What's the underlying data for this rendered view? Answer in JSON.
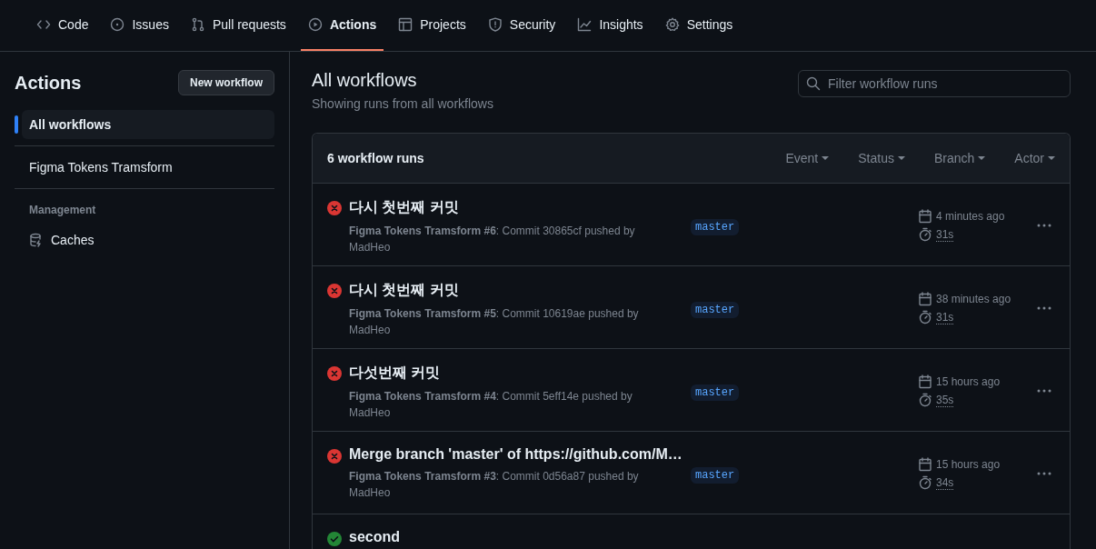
{
  "tabs": [
    {
      "label": "Code",
      "selected": false
    },
    {
      "label": "Issues",
      "selected": false
    },
    {
      "label": "Pull requests",
      "selected": false
    },
    {
      "label": "Actions",
      "selected": true
    },
    {
      "label": "Projects",
      "selected": false
    },
    {
      "label": "Security",
      "selected": false
    },
    {
      "label": "Insights",
      "selected": false
    },
    {
      "label": "Settings",
      "selected": false
    }
  ],
  "sidebar": {
    "title": "Actions",
    "new_button": "New workflow",
    "items": [
      {
        "label": "All workflows",
        "selected": true
      },
      {
        "label": "Figma Tokens Tramsform",
        "selected": false
      }
    ],
    "section_heading": "Management",
    "section_items": [
      {
        "label": "Caches",
        "selected": false
      }
    ]
  },
  "main": {
    "title": "All workflows",
    "subtitle": "Showing runs from all workflows",
    "search": {
      "placeholder": "Filter workflow runs"
    },
    "runs_count": "6 workflow runs",
    "filters": [
      "Event",
      "Status",
      "Branch",
      "Actor"
    ],
    "runs": [
      {
        "kind": "failure",
        "title": "다시 첫번째 커밋",
        "description": "**Figma Tokens Tramsform #6**: Commit 30865cf pushed by MadHeo",
        "branch": "master",
        "time": "4 minutes ago",
        "duration": "31s"
      },
      {
        "kind": "failure",
        "title": "다시 첫번째 커밋",
        "description": "**Figma Tokens Tramsform #5**: Commit 10619ae pushed by MadHeo",
        "branch": "master",
        "time": "38 minutes ago",
        "duration": "31s"
      },
      {
        "kind": "failure",
        "title": "다섯번째 커밋",
        "description": "**Figma Tokens Tramsform #4**: Commit 5eff14e pushed by MadHeo",
        "branch": "master",
        "time": "15 hours ago",
        "duration": "35s"
      },
      {
        "kind": "failure",
        "title": "Merge branch 'master' of https://github.com/M…",
        "description": "**Figma Tokens Tramsform #3**: Commit 0d56a87 pushed by MadHeo",
        "branch": "master",
        "time": "15 hours ago",
        "duration": "34s"
      },
      {
        "kind": "success",
        "title": "second"
      }
    ]
  }
}
